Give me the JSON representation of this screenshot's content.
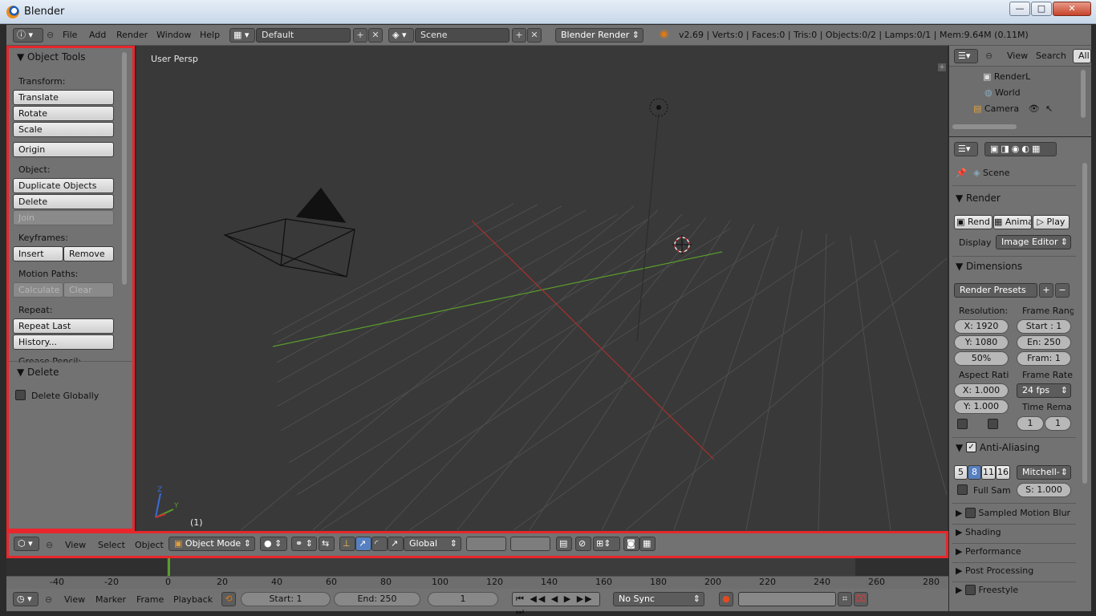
{
  "window": {
    "title": "Blender",
    "minimize": "—",
    "maximize": "□",
    "close": "✕"
  },
  "infobar": {
    "menus": [
      "File",
      "Add",
      "Render",
      "Window",
      "Help"
    ],
    "screen_layout": "Default",
    "scene": "Scene",
    "render_engine": "Blender Render",
    "stats": "v2.69 | Verts:0 | Faces:0 | Tris:0 | Objects:0/2 | Lamps:0/1 | Mem:9.64M (0.11M)"
  },
  "toolshelf": {
    "object_tools_title": "Object Tools",
    "transform_label": "Transform:",
    "translate": "Translate",
    "rotate": "Rotate",
    "scale": "Scale",
    "origin": "Origin",
    "object_label": "Object:",
    "duplicate_objects": "Duplicate Objects",
    "delete": "Delete",
    "join": "Join",
    "keyframes_label": "Keyframes:",
    "insert": "Insert",
    "remove": "Remove",
    "motion_paths_label": "Motion Paths:",
    "calculate": "Calculate",
    "clear": "Clear",
    "repeat_label": "Repeat:",
    "repeat_last": "Repeat Last",
    "history": "History...",
    "grease_pencil_label": "Grease Pencil:",
    "delete_panel_title": "Delete",
    "delete_globally": "Delete Globally"
  },
  "viewport": {
    "view_name": "User Persp",
    "frame_indicator": "(1)"
  },
  "viewport_header": {
    "menus": [
      "View",
      "Select",
      "Object"
    ],
    "mode": "Object Mode",
    "orientation": "Global"
  },
  "timeline": {
    "ticks": [
      "-40",
      "-20",
      "0",
      "20",
      "40",
      "60",
      "80",
      "100",
      "120",
      "140",
      "160",
      "180",
      "200",
      "220",
      "240",
      "260",
      "280"
    ],
    "current_frame_marker": 0
  },
  "timeline_header": {
    "menus": [
      "View",
      "Marker",
      "Frame",
      "Playback"
    ],
    "start": "Start: 1",
    "end": "End: 250",
    "current": "1",
    "sync": "No Sync"
  },
  "outliner": {
    "view": "View",
    "search": "Search",
    "all_scenes": "All",
    "rows": [
      "RenderL",
      "World",
      "Camera"
    ]
  },
  "properties": {
    "scene_label": "Scene",
    "render_title": "Render",
    "render_btn": "Rend",
    "anim_btn": "Anima",
    "play_btn": "Play",
    "display_label": "Display",
    "display_value": "Image Editor",
    "dimensions_title": "Dimensions",
    "render_presets": "Render Presets",
    "resolution_label": "Resolution:",
    "frame_range_label": "Frame Rang",
    "res_x": "X: 1920",
    "res_y": "Y: 1080",
    "res_pct": "50%",
    "start": "Start : 1",
    "end": "En: 250",
    "frame": "Fram: 1",
    "aspect_label": "Aspect Rati",
    "frame_rate_label": "Frame Rate:",
    "aspect_x": "X: 1.000",
    "aspect_y": "Y: 1.000",
    "fps": "24 fps",
    "time_remap_label": "Time Rema",
    "remap_old": "1",
    "remap_new": "1",
    "aa_title": "Anti-Aliasing",
    "aa_samples": [
      "5",
      "8",
      "11",
      "16"
    ],
    "aa_filter": "Mitchell-",
    "full_sample": "Full Sam",
    "aa_size": "S: 1.000",
    "sampled_motion_blur": "Sampled Motion Blur",
    "shading": "Shading",
    "performance": "Performance",
    "post_processing": "Post Processing",
    "freestyle": "Freestyle"
  },
  "colors": {
    "highlight_red": "#e8262b",
    "x_axis": "#a8302c",
    "y_axis": "#5a9c2d",
    "selected_blue": "#5680c2"
  }
}
